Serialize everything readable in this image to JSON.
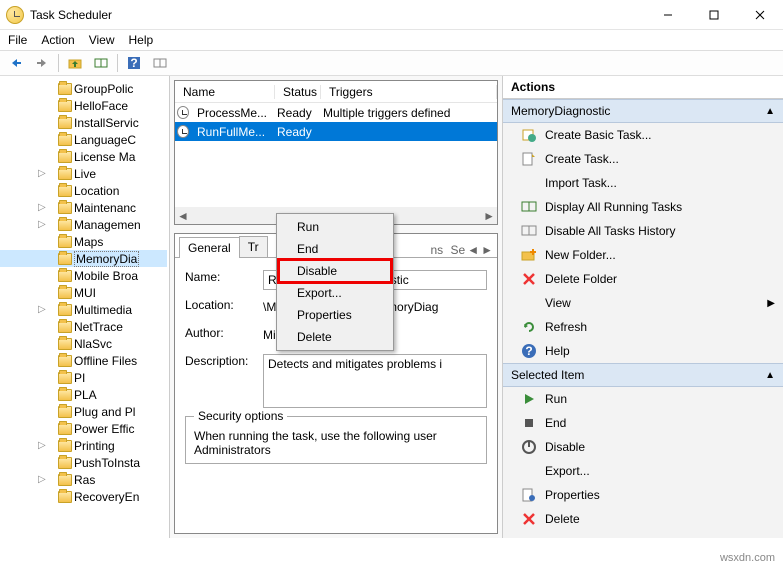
{
  "window": {
    "title": "Task Scheduler"
  },
  "menu": {
    "file": "File",
    "action": "Action",
    "view": "View",
    "help": "Help"
  },
  "tree": {
    "items": [
      "GroupPolic",
      "HelloFace",
      "InstallServic",
      "LanguageC",
      "License Ma",
      "Live",
      "Location",
      "Maintenanc",
      "Managemen",
      "Maps",
      "MemoryDia",
      "Mobile Broa",
      "MUI",
      "Multimedia",
      "NetTrace",
      "NlaSvc",
      "Offline Files",
      "PI",
      "PLA",
      "Plug and Pl",
      "Power Effic",
      "Printing",
      "PushToInsta",
      "Ras",
      "RecoveryEn"
    ],
    "selected_index": 10
  },
  "tasks": {
    "columns": {
      "name": "Name",
      "status": "Status",
      "triggers": "Triggers"
    },
    "rows": [
      {
        "name": "ProcessMe...",
        "status": "Ready",
        "triggers": "Multiple triggers defined"
      },
      {
        "name": "RunFullMe...",
        "status": "Ready",
        "triggers": ""
      }
    ],
    "selected_index": 1
  },
  "context_menu": {
    "items": [
      "Run",
      "End",
      "Disable",
      "Export...",
      "Properties",
      "Delete"
    ],
    "highlight_index": 2
  },
  "detail": {
    "tabs": [
      "General",
      "Tr",
      "ns",
      "Se"
    ],
    "active_tab": 0,
    "name_label": "Name:",
    "name_value": "RunFullMemoryDiagnostic",
    "location_label": "Location:",
    "location_value": "\\Microsoft\\Windows\\MemoryDiag",
    "author_label": "Author:",
    "author_value": "Microsoft Corporation",
    "description_label": "Description:",
    "description_value": "Detects and mitigates problems i",
    "security_legend": "Security options",
    "security_line1": "When running the task, use the following user",
    "security_line2": "Administrators"
  },
  "actions": {
    "title": "Actions",
    "section1": "MemoryDiagnostic",
    "items1": [
      {
        "label": "Create Basic Task...",
        "icon": "create-basic"
      },
      {
        "label": "Create Task...",
        "icon": "create"
      },
      {
        "label": "Import Task...",
        "icon": "import"
      },
      {
        "label": "Display All Running Tasks",
        "icon": "display"
      },
      {
        "label": "Disable All Tasks History",
        "icon": "disable-history"
      },
      {
        "label": "New Folder...",
        "icon": "new-folder"
      },
      {
        "label": "Delete Folder",
        "icon": "delete-folder"
      },
      {
        "label": "View",
        "icon": "view",
        "submenu": true
      },
      {
        "label": "Refresh",
        "icon": "refresh"
      },
      {
        "label": "Help",
        "icon": "help"
      }
    ],
    "section2": "Selected Item",
    "items2": [
      {
        "label": "Run",
        "icon": "run"
      },
      {
        "label": "End",
        "icon": "end"
      },
      {
        "label": "Disable",
        "icon": "disable"
      },
      {
        "label": "Export...",
        "icon": "export"
      },
      {
        "label": "Properties",
        "icon": "properties"
      },
      {
        "label": "Delete",
        "icon": "delete"
      }
    ]
  },
  "watermark": "wsxdn.com"
}
